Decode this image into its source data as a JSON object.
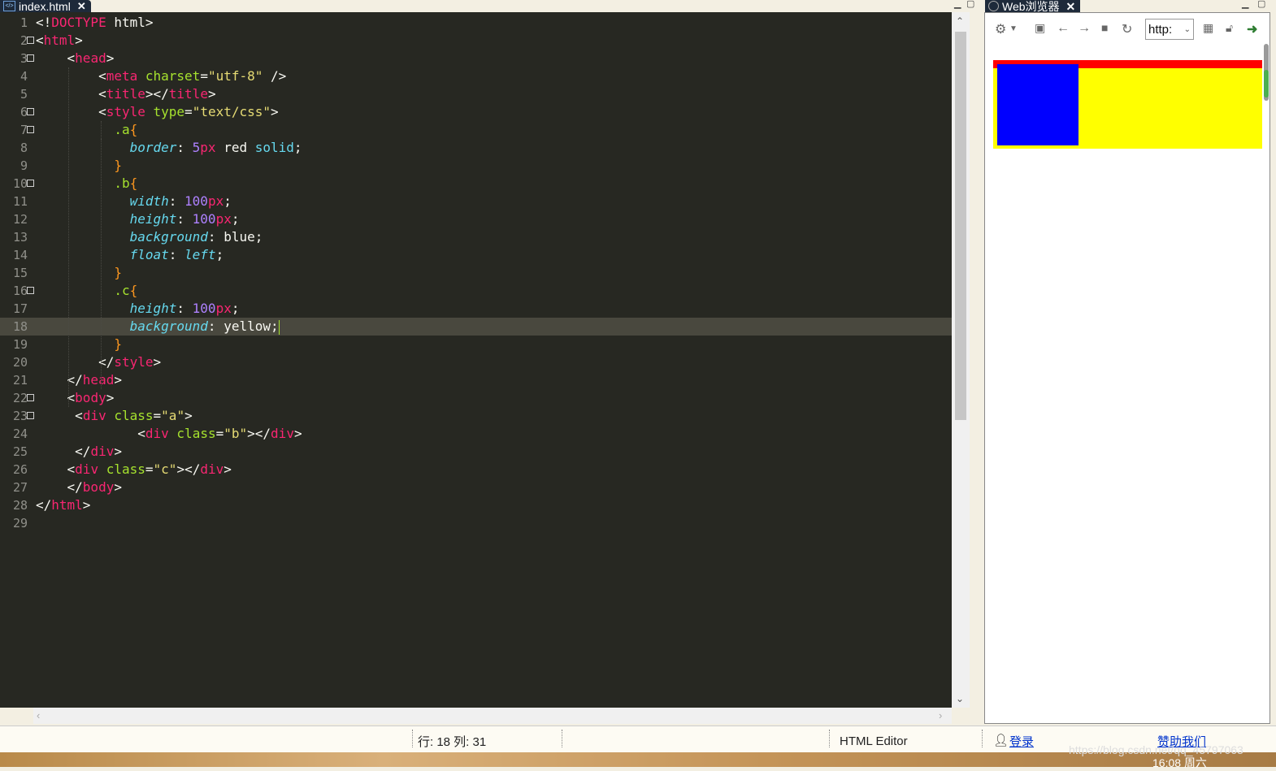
{
  "editor_tab": {
    "label": "index.html",
    "close": "✕"
  },
  "browser_tab": {
    "label": "Web浏览器",
    "close": "✕"
  },
  "code_lines": [
    {
      "n": "1",
      "fold": false,
      "current": false,
      "html": "<span class='p'>&lt;!</span><span class='t'>DOCTYPE</span><span class='p'> html&gt;</span>"
    },
    {
      "n": "2",
      "fold": true,
      "current": false,
      "html": "<span class='p'>&lt;</span><span class='t'>html</span><span class='p'>&gt;</span>"
    },
    {
      "n": "3",
      "fold": true,
      "current": false,
      "html": "    <span class='p'>&lt;</span><span class='t'>head</span><span class='p'>&gt;</span>"
    },
    {
      "n": "4",
      "fold": false,
      "current": false,
      "html": "        <span class='p'>&lt;</span><span class='t'>meta</span> <span class='a'>charset</span><span class='p'>=</span><span class='s'>\"utf-8\"</span><span class='p'> /&gt;</span>"
    },
    {
      "n": "5",
      "fold": false,
      "current": false,
      "html": "        <span class='p'>&lt;</span><span class='t'>title</span><span class='p'>&gt;&lt;/</span><span class='t'>title</span><span class='p'>&gt;</span>"
    },
    {
      "n": "6",
      "fold": true,
      "current": false,
      "html": "        <span class='p'>&lt;</span><span class='t'>style</span> <span class='a'>type</span><span class='p'>=</span><span class='s'>\"text/css\"</span><span class='p'>&gt;</span>"
    },
    {
      "n": "7",
      "fold": true,
      "current": false,
      "html": "          <span class='a'>.a</span><span class='b'>{</span>"
    },
    {
      "n": "8",
      "fold": false,
      "current": false,
      "html": "            <span class='k'>border</span><span class='p'>: </span><span class='n'>5</span><span class='t'>px</span><span class='p'> red </span><span class='v'>solid</span><span class='p'>;</span>"
    },
    {
      "n": "9",
      "fold": false,
      "current": false,
      "html": "          <span class='b'>}</span>"
    },
    {
      "n": "10",
      "fold": true,
      "current": false,
      "html": "          <span class='a'>.b</span><span class='b'>{</span>"
    },
    {
      "n": "11",
      "fold": false,
      "current": false,
      "html": "            <span class='k'>width</span><span class='p'>: </span><span class='n'>100</span><span class='t'>px</span><span class='p'>;</span>"
    },
    {
      "n": "12",
      "fold": false,
      "current": false,
      "html": "            <span class='k'>height</span><span class='p'>: </span><span class='n'>100</span><span class='t'>px</span><span class='p'>;</span>"
    },
    {
      "n": "13",
      "fold": false,
      "current": false,
      "html": "            <span class='k'>background</span><span class='p'>: blue;</span>"
    },
    {
      "n": "14",
      "fold": false,
      "current": false,
      "html": "            <span class='k'>float</span><span class='p'>: </span><span class='k'>left</span><span class='p'>;</span>"
    },
    {
      "n": "15",
      "fold": false,
      "current": false,
      "html": "          <span class='b'>}</span>"
    },
    {
      "n": "16",
      "fold": true,
      "current": false,
      "html": "          <span class='a'>.c</span><span class='b'>{</span>"
    },
    {
      "n": "17",
      "fold": false,
      "current": false,
      "html": "            <span class='k'>height</span><span class='p'>: </span><span class='n'>100</span><span class='t'>px</span><span class='p'>;</span>"
    },
    {
      "n": "18",
      "fold": false,
      "current": true,
      "html": "            <span class='k'>background</span><span class='p'>: yellow;</span><span class='caret'></span>"
    },
    {
      "n": "19",
      "fold": false,
      "current": false,
      "html": "          <span class='b'>}</span>"
    },
    {
      "n": "20",
      "fold": false,
      "current": false,
      "html": "        <span class='p'>&lt;/</span><span class='t'>style</span><span class='p'>&gt;</span>"
    },
    {
      "n": "21",
      "fold": false,
      "current": false,
      "html": "    <span class='p'>&lt;/</span><span class='t'>head</span><span class='p'>&gt;</span>"
    },
    {
      "n": "22",
      "fold": true,
      "current": false,
      "html": "    <span class='p'>&lt;</span><span class='t'>body</span><span class='p'>&gt;</span>"
    },
    {
      "n": "23",
      "fold": true,
      "current": false,
      "html": "     <span class='p'>&lt;</span><span class='t'>div</span> <span class='a'>class</span><span class='p'>=</span><span class='s'>\"a\"</span><span class='p'>&gt;</span>"
    },
    {
      "n": "24",
      "fold": false,
      "current": false,
      "html": "             <span class='p'>&lt;</span><span class='t'>div</span> <span class='a'>class</span><span class='p'>=</span><span class='s'>\"b\"</span><span class='p'>&gt;&lt;/</span><span class='t'>div</span><span class='p'>&gt;</span>"
    },
    {
      "n": "25",
      "fold": false,
      "current": false,
      "html": "     <span class='p'>&lt;/</span><span class='t'>div</span><span class='p'>&gt;</span>"
    },
    {
      "n": "26",
      "fold": false,
      "current": false,
      "html": "    <span class='p'>&lt;</span><span class='t'>div</span> <span class='a'>class</span><span class='p'>=</span><span class='s'>\"c\"</span><span class='p'>&gt;&lt;/</span><span class='t'>div</span><span class='p'>&gt;</span>"
    },
    {
      "n": "27",
      "fold": false,
      "current": false,
      "html": "    <span class='p'>&lt;/</span><span class='t'>body</span><span class='p'>&gt;</span>"
    },
    {
      "n": "28",
      "fold": false,
      "current": false,
      "html": "<span class='p'>&lt;/</span><span class='t'>html</span><span class='p'>&gt;</span>"
    },
    {
      "n": "29",
      "fold": false,
      "current": false,
      "html": ""
    }
  ],
  "browser": {
    "url": "http:",
    "icons": [
      "gear-icon",
      "dropdown-icon",
      "console-icon",
      "back-icon",
      "forward-icon",
      "stop-icon",
      "refresh-icon"
    ],
    "right_icons": [
      "qr-icon",
      "lock-icon",
      "go-icon"
    ]
  },
  "status": {
    "position": "行: 18 列: 31",
    "mode": "HTML Editor",
    "login": "登录",
    "sponsor": "赞助我们"
  },
  "watermark": "https://blog.csdn.net/qq_45797063",
  "clock": "16:08 周六"
}
